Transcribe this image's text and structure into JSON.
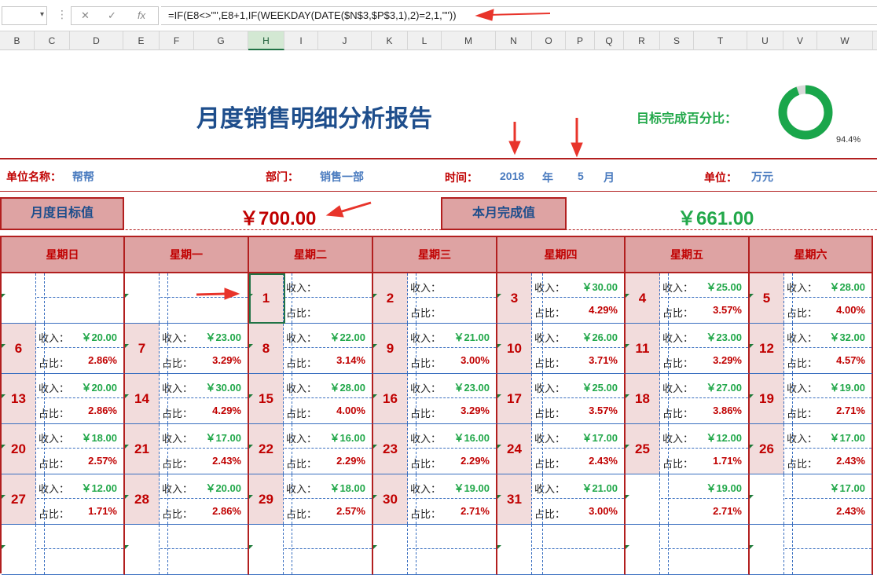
{
  "formula_bar": {
    "name_box": "",
    "fx": "fx",
    "formula": "=IF(E8<>\"\",E8+1,IF(WEEKDAY(DATE($N$3,$P$3,1),2)=2,1,\"\"))"
  },
  "columns": [
    "B",
    "C",
    "D",
    "E",
    "F",
    "G",
    "H",
    "I",
    "J",
    "K",
    "L",
    "M",
    "N",
    "O",
    "P",
    "Q",
    "R",
    "S",
    "T",
    "U",
    "V",
    "W"
  ],
  "report": {
    "title": "月度销售明细分析报告",
    "goal_label": "目标完成百分比：",
    "goal_pct": "94.4%",
    "goal_fraction": 0.944,
    "unit_name_label": "单位名称：",
    "unit_name": "帮帮",
    "dept_label": "部门：",
    "dept": "销售一部",
    "time_label": "时间：",
    "year": "2018",
    "year_unit": "年",
    "month": "5",
    "month_unit": "月",
    "unit_label": "单位：",
    "unit": "万元",
    "target_label": "月度目标值",
    "target_value": "￥700.00",
    "done_label": "本月完成值",
    "done_value": "￥661.00"
  },
  "calendar": {
    "weekdays": [
      "星期日",
      "星期一",
      "星期二",
      "星期三",
      "星期四",
      "星期五",
      "星期六"
    ],
    "income_label": "收入：",
    "ratio_label": "占比：",
    "weeks": [
      [
        {
          "d": "",
          "i": "",
          "p": ""
        },
        {
          "d": "",
          "i": "",
          "p": ""
        },
        {
          "d": "1",
          "i": "",
          "p": ""
        },
        {
          "d": "2",
          "i": "",
          "p": ""
        },
        {
          "d": "3",
          "i": "￥30.00",
          "p": "4.29%"
        },
        {
          "d": "4",
          "i": "￥25.00",
          "p": "3.57%"
        },
        {
          "d": "5",
          "i": "￥28.00",
          "p": "4.00%"
        }
      ],
      [
        {
          "d": "6",
          "i": "￥20.00",
          "p": "2.86%"
        },
        {
          "d": "7",
          "i": "￥23.00",
          "p": "3.29%"
        },
        {
          "d": "8",
          "i": "￥22.00",
          "p": "3.14%"
        },
        {
          "d": "9",
          "i": "￥21.00",
          "p": "3.00%"
        },
        {
          "d": "10",
          "i": "￥26.00",
          "p": "3.71%"
        },
        {
          "d": "11",
          "i": "￥23.00",
          "p": "3.29%"
        },
        {
          "d": "12",
          "i": "￥32.00",
          "p": "4.57%"
        }
      ],
      [
        {
          "d": "13",
          "i": "￥20.00",
          "p": "2.86%"
        },
        {
          "d": "14",
          "i": "￥30.00",
          "p": "4.29%"
        },
        {
          "d": "15",
          "i": "￥28.00",
          "p": "4.00%"
        },
        {
          "d": "16",
          "i": "￥23.00",
          "p": "3.29%"
        },
        {
          "d": "17",
          "i": "￥25.00",
          "p": "3.57%"
        },
        {
          "d": "18",
          "i": "￥27.00",
          "p": "3.86%"
        },
        {
          "d": "19",
          "i": "￥19.00",
          "p": "2.71%"
        }
      ],
      [
        {
          "d": "20",
          "i": "￥18.00",
          "p": "2.57%"
        },
        {
          "d": "21",
          "i": "￥17.00",
          "p": "2.43%"
        },
        {
          "d": "22",
          "i": "￥16.00",
          "p": "2.29%"
        },
        {
          "d": "23",
          "i": "￥16.00",
          "p": "2.29%"
        },
        {
          "d": "24",
          "i": "￥17.00",
          "p": "2.43%"
        },
        {
          "d": "25",
          "i": "￥12.00",
          "p": "1.71%"
        },
        {
          "d": "26",
          "i": "￥17.00",
          "p": "2.43%"
        }
      ],
      [
        {
          "d": "27",
          "i": "￥12.00",
          "p": "1.71%"
        },
        {
          "d": "28",
          "i": "￥20.00",
          "p": "2.86%"
        },
        {
          "d": "29",
          "i": "￥18.00",
          "p": "2.57%"
        },
        {
          "d": "30",
          "i": "￥19.00",
          "p": "2.71%"
        },
        {
          "d": "31",
          "i": "￥21.00",
          "p": "3.00%"
        },
        {
          "d": "",
          "i": "￥19.00",
          "p": "2.71%"
        },
        {
          "d": "",
          "i": "￥17.00",
          "p": "2.43%"
        }
      ],
      [
        {
          "d": "",
          "i": "",
          "p": ""
        },
        {
          "d": "",
          "i": "",
          "p": ""
        },
        {
          "d": "",
          "i": "",
          "p": ""
        },
        {
          "d": "",
          "i": "",
          "p": ""
        },
        {
          "d": "",
          "i": "",
          "p": ""
        },
        {
          "d": "",
          "i": "",
          "p": ""
        },
        {
          "d": "",
          "i": "",
          "p": ""
        }
      ]
    ]
  },
  "colors": {
    "header_red": "#b21f1f",
    "header_fill": "#dea3a3",
    "green": "#22a84a",
    "blue": "#1e4e8c"
  }
}
